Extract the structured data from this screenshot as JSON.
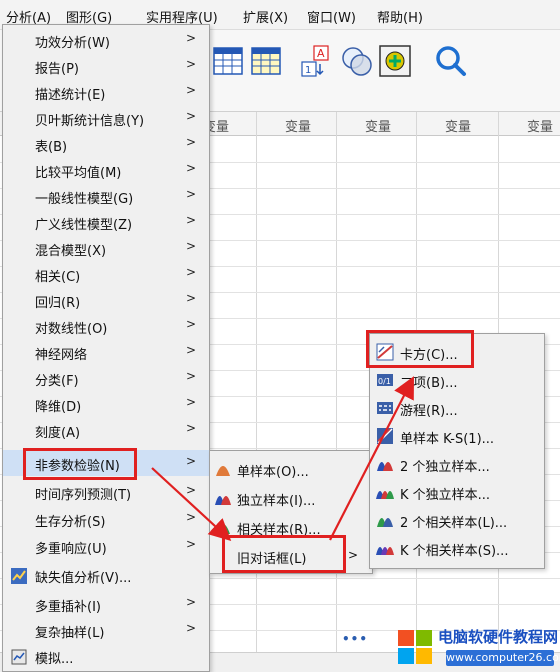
{
  "menubar": {
    "items": [
      "分析(A)",
      "图形(G)",
      "实用程序(U)",
      "扩展(X)",
      "窗口(W)",
      "帮助(H)"
    ]
  },
  "grid": {
    "column_header": "变量"
  },
  "analyze_menu": {
    "items": [
      {
        "label": "功效分析(W)",
        "submenu": true
      },
      {
        "label": "报告(P)",
        "submenu": true
      },
      {
        "label": "描述统计(E)",
        "submenu": true
      },
      {
        "label": "贝叶斯统计信息(Y)",
        "submenu": true
      },
      {
        "label": "表(B)",
        "submenu": true
      },
      {
        "label": "比较平均值(M)",
        "submenu": true
      },
      {
        "label": "一般线性模型(G)",
        "submenu": true
      },
      {
        "label": "广义线性模型(Z)",
        "submenu": true
      },
      {
        "label": "混合模型(X)",
        "submenu": true
      },
      {
        "label": "相关(C)",
        "submenu": true
      },
      {
        "label": "回归(R)",
        "submenu": true
      },
      {
        "label": "对数线性(O)",
        "submenu": true
      },
      {
        "label": "神经网络",
        "submenu": true
      },
      {
        "label": "分类(F)",
        "submenu": true
      },
      {
        "label": "降维(D)",
        "submenu": true
      },
      {
        "label": "刻度(A)",
        "submenu": true
      },
      {
        "label": "非参数检验(N)",
        "submenu": true
      },
      {
        "label": "时间序列预测(T)",
        "submenu": true
      },
      {
        "label": "生存分析(S)",
        "submenu": true
      },
      {
        "label": "多重响应(U)",
        "submenu": true
      },
      {
        "label": "缺失值分析(V)...",
        "submenu": false
      },
      {
        "label": "多重插补(I)",
        "submenu": true
      },
      {
        "label": "复杂抽样(L)",
        "submenu": true
      },
      {
        "label": "模拟...",
        "submenu": false
      }
    ]
  },
  "nonparam_menu": {
    "items": [
      "单样本(O)...",
      "独立样本(I)...",
      "相关样本(R)...",
      "旧对话框(L)"
    ]
  },
  "legacy_menu": {
    "items": [
      "卡方(C)...",
      "二项(B)...",
      "游程(R)...",
      "单样本 K-S(1)...",
      "2 个独立样本...",
      "K 个独立样本...",
      "2 个相关样本(L)...",
      "K 个相关样本(S)..."
    ]
  },
  "watermark": {
    "line1": "电脑软硬件教程网",
    "line2": "www.computer26.com"
  },
  "colors": {
    "highlight": "#cfe0f5",
    "callout": "#e02020",
    "menu_bg": "#f0f0f0"
  }
}
